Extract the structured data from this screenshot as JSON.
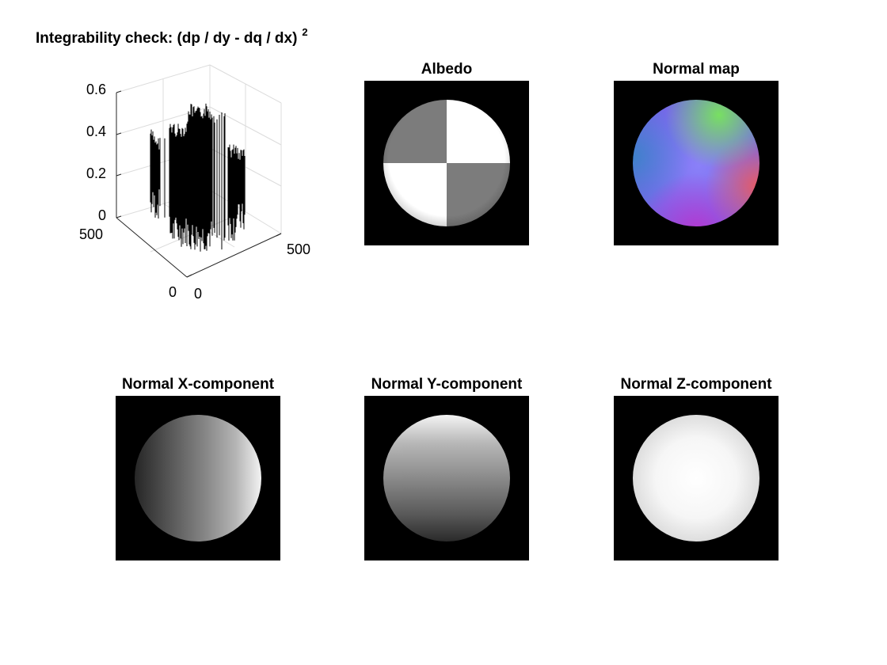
{
  "figure": {
    "integrability": {
      "title": "Integrability check: (dp / dy - dq / dx)",
      "title_superscript": "2",
      "z_ticks": [
        "0.6",
        "0.4",
        "0.2",
        "0"
      ],
      "y_ticks": [
        "500",
        "0"
      ],
      "x_ticks": [
        "0",
        "500"
      ]
    },
    "albedo": {
      "title": "Albedo"
    },
    "normal_map": {
      "title": "Normal map"
    },
    "normal_x": {
      "title": "Normal X-component"
    },
    "normal_y": {
      "title": "Normal Y-component"
    },
    "normal_z": {
      "title": "Normal Z-component"
    }
  },
  "chart_data": [
    {
      "type": "surface",
      "title": "Integrability check: (dp / dy - dq / dx) 2",
      "zlim": [
        0,
        0.6
      ],
      "z_ticks": [
        0,
        0.2,
        0.4,
        0.6
      ],
      "x_ticks": [
        0,
        500
      ],
      "y_ticks": [
        0,
        500
      ],
      "grid": true,
      "colors": {
        "surface": "#000000",
        "grid": "#dcdcdc"
      }
    },
    {
      "type": "image",
      "title": "Albedo",
      "colormap": "gray"
    },
    {
      "type": "image",
      "title": "Normal map",
      "colormap": "rgb"
    },
    {
      "type": "image",
      "title": "Normal X-component",
      "colormap": "gray"
    },
    {
      "type": "image",
      "title": "Normal Y-component",
      "colormap": "gray"
    },
    {
      "type": "image",
      "title": "Normal Z-component",
      "colormap": "gray"
    }
  ]
}
